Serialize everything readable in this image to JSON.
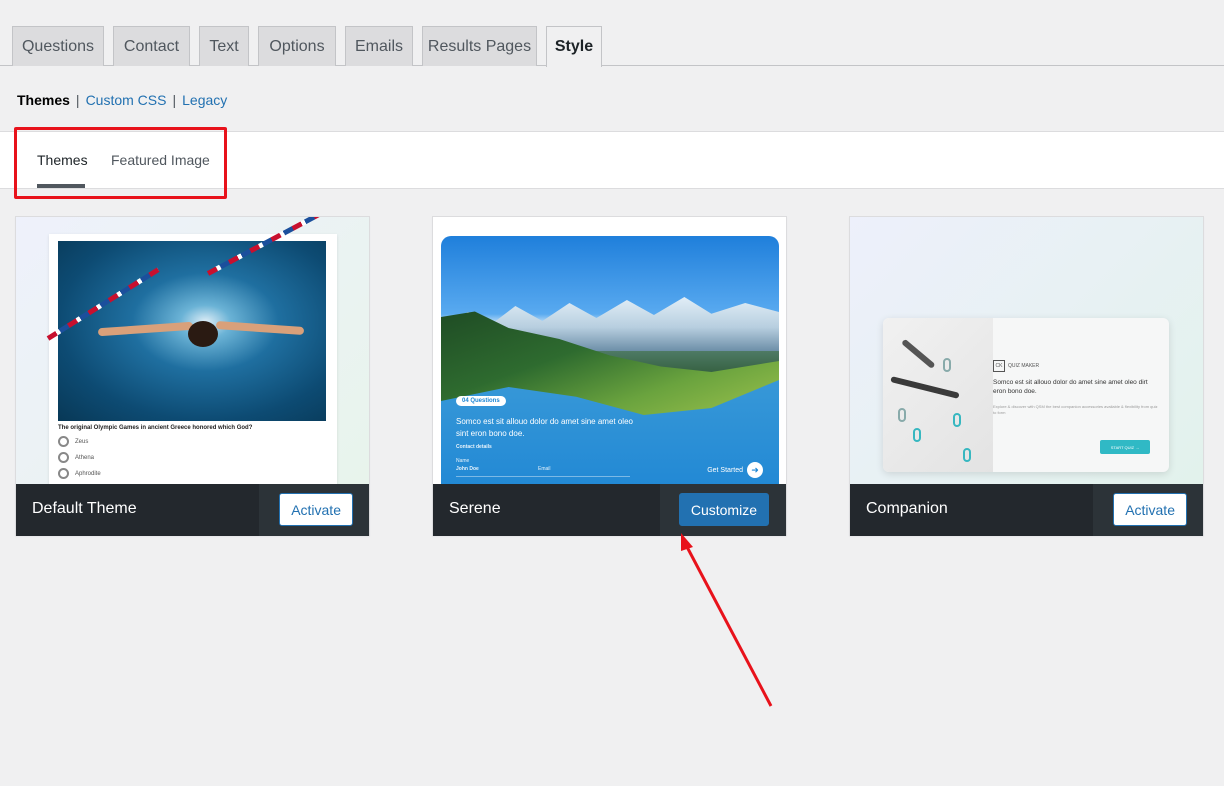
{
  "top_tabs": [
    "Questions",
    "Contact",
    "Text",
    "Options",
    "Emails",
    "Results Pages",
    "Style"
  ],
  "active_top_tab": "Style",
  "subnav": {
    "current": "Themes",
    "link1": "Custom CSS",
    "link2": "Legacy",
    "separator": "|"
  },
  "inner_tabs": {
    "themes": "Themes",
    "featured": "Featured Image"
  },
  "themes": [
    {
      "name": "Default Theme",
      "button": "Activate",
      "preview": {
        "question": "The original Olympic Games in ancient Greece honored which God?",
        "options": [
          "Zeus",
          "Athena",
          "Aphrodite"
        ]
      }
    },
    {
      "name": "Serene",
      "button": "Customize",
      "preview": {
        "pill": "04 Questions",
        "text": "Somco est sit allouo dolor do amet sine amet oleo sint eron bono doe.",
        "contact": "Contact details",
        "name_label": "Name",
        "name_value": "John Doe",
        "email_label": "Email",
        "start": "Get Started"
      }
    },
    {
      "name": "Companion",
      "button": "Activate",
      "preview": {
        "logo": "QUIZ MAKER",
        "logo_mark": "CK",
        "text": "Somco est sit allouo dolor do amet sine amet oleo dirt eron bono doe.",
        "sub": "Explore & discover with QSM the best companion accessories available & flexibility from quiz to form",
        "start": "START QUIZ →"
      }
    }
  ],
  "colors": {
    "accent": "#2271b1",
    "highlight": "#e8121b",
    "footer": "#23282d"
  }
}
